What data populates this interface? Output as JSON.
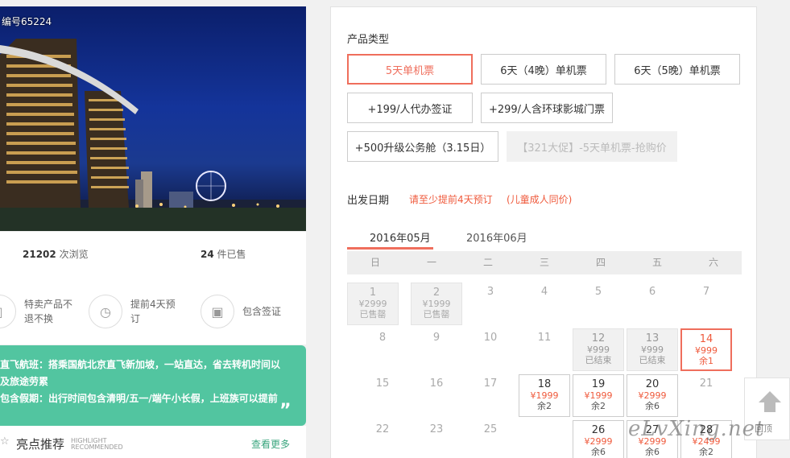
{
  "hero": {
    "product_code": "编号65224"
  },
  "stats": {
    "views_num": "21202",
    "views_label": "次浏览",
    "sold_num": "24",
    "sold_label": "件已售"
  },
  "features": [
    {
      "icon": "shield-icon",
      "line1": "特卖产品不",
      "line2": "退不换"
    },
    {
      "icon": "clock-icon",
      "line1": "提前4天预",
      "line2": "订"
    },
    {
      "icon": "passport-icon",
      "line1": "包含签证",
      "line2": ""
    }
  ],
  "notice": {
    "line1": "直飞航班：搭乘国航北京直飞新加坡，一站直达，省去转机时间以",
    "line2": "及旅途劳累",
    "line3": "包含假期：出行时间包含清明/五一/端午小长假，上班族可以提前",
    "quote": "„"
  },
  "highlight": {
    "title": "亮点推荐",
    "en1": "HIGHLIGHT",
    "en2": "RECOMMENDED",
    "more": "查看更多"
  },
  "product_type": {
    "title": "产品类型",
    "options": [
      "5天单机票",
      "6天（4晚）单机票",
      "6天（5晚）单机票",
      "+199/人代办签证",
      "+299/人含环球影城门票",
      "+500升级公务舱（3.15日）",
      "【321大促】-5天单机票-抢购价"
    ]
  },
  "departure": {
    "title": "出发日期",
    "note1": "请至少提前4天预订",
    "note2": "(儿童成人同价)"
  },
  "months": [
    "2016年05月",
    "2016年06月"
  ],
  "weekdays": [
    "日",
    "一",
    "二",
    "三",
    "四",
    "五",
    "六"
  ],
  "calendar": [
    {
      "day": "1",
      "price": "¥2999",
      "status": "已售罄"
    },
    {
      "day": "2",
      "price": "¥1999",
      "status": "已售罄"
    },
    {
      "day": "3"
    },
    {
      "day": "4"
    },
    {
      "day": "5"
    },
    {
      "day": "6"
    },
    {
      "day": "7"
    },
    {
      "day": "8"
    },
    {
      "day": "9"
    },
    {
      "day": "10"
    },
    {
      "day": "11"
    },
    {
      "day": "12",
      "price": "¥999",
      "status": "已结束"
    },
    {
      "day": "13",
      "price": "¥999",
      "status": "已结束"
    },
    {
      "day": "14",
      "price": "¥999",
      "status": "余1"
    },
    {
      "day": "15"
    },
    {
      "day": "16"
    },
    {
      "day": "17"
    },
    {
      "day": "18",
      "price": "¥1999",
      "status": "余2"
    },
    {
      "day": "19",
      "price": "¥1999",
      "status": "余2"
    },
    {
      "day": "20",
      "price": "¥2999",
      "status": "余6"
    },
    {
      "day": "21"
    },
    {
      "day": "22"
    },
    {
      "day": "23"
    },
    {
      "day": "25"
    },
    {
      "day": "26",
      "price": "¥2999",
      "status": "余6"
    },
    {
      "day": "27",
      "price": "¥2999",
      "status": "余6"
    },
    {
      "day": "28",
      "price": "¥2499",
      "status": "余2"
    }
  ],
  "back_top": {
    "label": "回顶"
  },
  "watermark": "eLvXing.net"
}
